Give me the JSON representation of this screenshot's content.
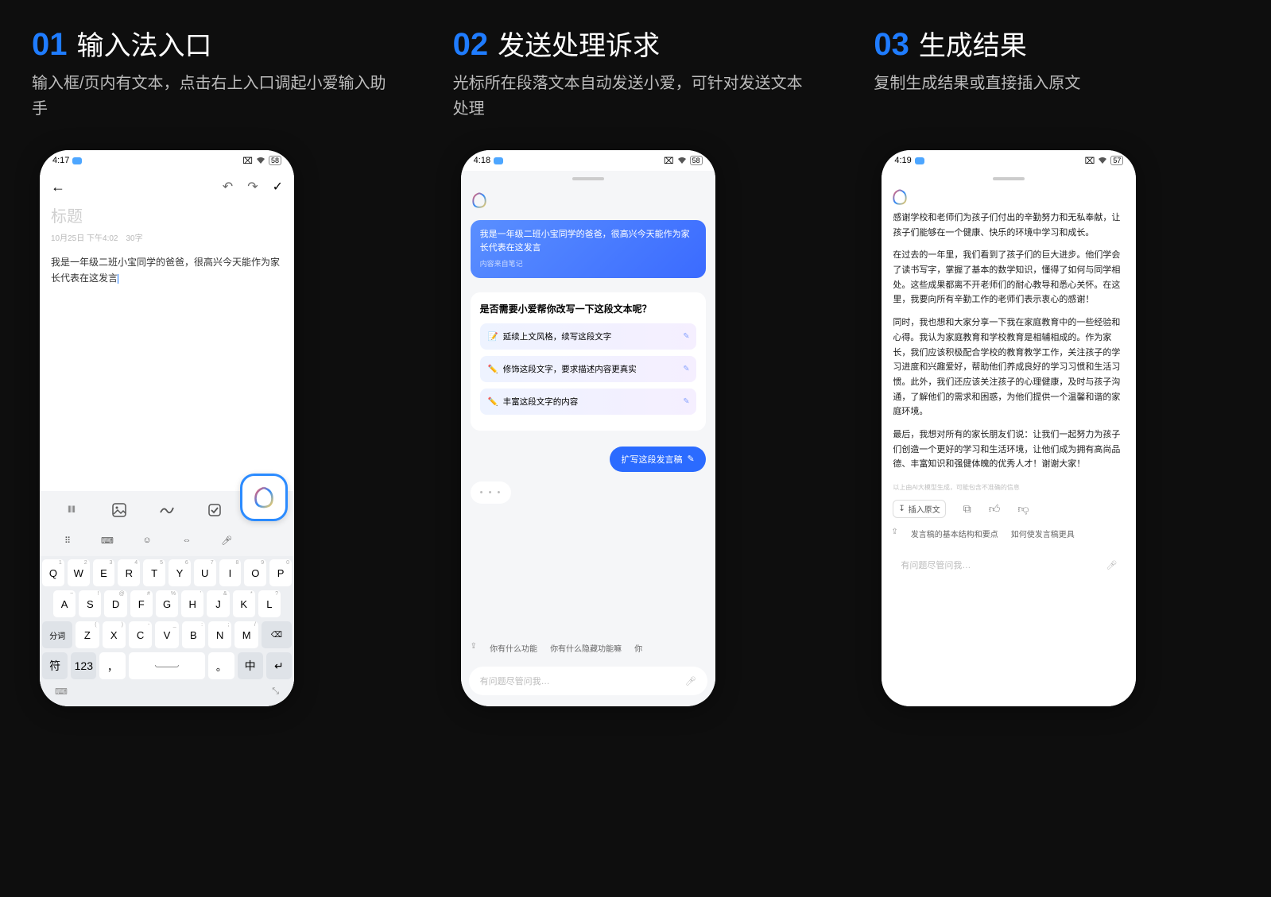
{
  "steps": [
    {
      "num": "01",
      "title": "输入法入口",
      "desc": "输入框/页内有文本，点击右上入口调起小爱输入助手"
    },
    {
      "num": "02",
      "title": "发送处理诉求",
      "desc": "光标所在段落文本自动发送小爱，可针对发送文本处理"
    },
    {
      "num": "03",
      "title": "生成结果",
      "desc": "复制生成结果或直接插入原文"
    }
  ],
  "status": {
    "t1": "4:17",
    "t2": "4:18",
    "t3": "4:19",
    "batt1": "58",
    "batt2": "58",
    "batt3": "57"
  },
  "phone1": {
    "title_placeholder": "标题",
    "date": "10月25日 下午4:02",
    "wordcount": "30字",
    "body": "我是一年级二班小宝同学的爸爸，很高兴今天能作为家长代表在这发言",
    "key_rows": {
      "r1": [
        "Q",
        "W",
        "E",
        "R",
        "T",
        "Y",
        "U",
        "I",
        "O",
        "P"
      ],
      "r1h": [
        "1",
        "2",
        "3",
        "4",
        "5",
        "6",
        "7",
        "8",
        "9",
        "0"
      ],
      "r2": [
        "A",
        "S",
        "D",
        "F",
        "G",
        "H",
        "J",
        "K",
        "L"
      ],
      "r2h": [
        "~",
        "!",
        "@",
        "#",
        "%",
        "'",
        "&",
        "*",
        "?"
      ],
      "r3_left": "分词",
      "r3": [
        "Z",
        "X",
        "C",
        "V",
        "B",
        "N",
        "M"
      ],
      "r3h": [
        "(",
        ")",
        "-",
        "_",
        ":",
        ";",
        "/"
      ],
      "r3_right_icon": "backspace",
      "r4": {
        "sym": "符",
        "num": "123",
        "comma": "，",
        "space": "␣",
        "period": "。",
        "lang": "中",
        "enter": "↵"
      }
    }
  },
  "phone2": {
    "user_msg": "我是一年级二班小宝同学的爸爸，很高兴今天能作为家长代表在这发言",
    "user_src": "内容来自笔记",
    "prompt_q": "是否需要小爱帮你改写一下这段文本呢？",
    "options": [
      "延续上文风格，续写这段文字",
      "修饰这段文字，要求描述内容更真实",
      "丰富这段文字的内容"
    ],
    "option_icons": [
      "📝",
      "✏️",
      "✏️"
    ],
    "chip": "扩写这段发言稿",
    "suggestions": [
      "你有什么功能",
      "你有什么隐藏功能嘛",
      "你"
    ],
    "ask_placeholder": "有问题尽管问我…"
  },
  "phone3": {
    "paras": [
      "感谢学校和老师们为孩子们付出的辛勤努力和无私奉献，让孩子们能够在一个健康、快乐的环境中学习和成长。",
      "在过去的一年里，我们看到了孩子们的巨大进步。他们学会了读书写字，掌握了基本的数学知识，懂得了如何与同学相处。这些成果都离不开老师们的耐心教导和悉心关怀。在这里，我要向所有辛勤工作的老师们表示衷心的感谢！",
      "同时，我也想和大家分享一下我在家庭教育中的一些经验和心得。我认为家庭教育和学校教育是相辅相成的。作为家长，我们应该积极配合学校的教育教学工作，关注孩子的学习进度和兴趣爱好，帮助他们养成良好的学习习惯和生活习惯。此外，我们还应该关注孩子的心理健康，及时与孩子沟通，了解他们的需求和困惑，为他们提供一个温馨和谐的家庭环境。",
      "最后，我想对所有的家长朋友们说：让我们一起努力为孩子们创造一个更好的学习和生活环境，让他们成为拥有高尚品德、丰富知识和强健体魄的优秀人才！谢谢大家！"
    ],
    "disclaimer": "以上由AI大模型生成，可能包含不准确的信息",
    "insert_label": "插入原文",
    "suggestions": [
      "发言稿的基本结构和要点",
      "如何使发言稿更具"
    ],
    "ask_placeholder": "有问题尽管问我…"
  }
}
